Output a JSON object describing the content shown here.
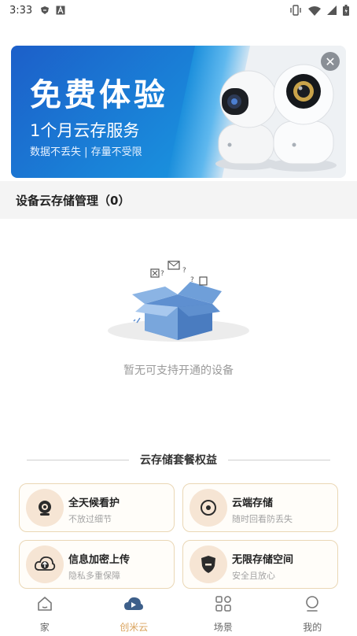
{
  "status_bar": {
    "time": "3:33",
    "left_icons": [
      "shield-icon",
      "a-badge-icon"
    ],
    "right_icons": [
      "vibrate-icon",
      "wifi-icon",
      "signal-icon",
      "battery-icon"
    ]
  },
  "banner": {
    "title": "免费体验",
    "subtitle": "1个月云存服务",
    "note": "数据不丢失 | 存量不受限",
    "close_symbol": "✕",
    "accent_color": "#1a78d6"
  },
  "devices": {
    "header": "设备云存储管理（0）",
    "empty_text": "暂无可支持开通的设备"
  },
  "benefits": {
    "title": "云存储套餐权益",
    "items": [
      {
        "title": "全天候看护",
        "desc": "不放过细节",
        "icon": "camera-icon"
      },
      {
        "title": "云端存储",
        "desc": "随时回看防丢失",
        "icon": "cloud-storage-icon"
      },
      {
        "title": "信息加密上传",
        "desc": "隐私多重保障",
        "icon": "upload-icon"
      },
      {
        "title": "无限存储空间",
        "desc": "安全且放心",
        "icon": "shield-icon"
      }
    ]
  },
  "tabbar": {
    "active_color": "#d9a25b",
    "tabs": [
      {
        "label": "家",
        "icon": "home-icon"
      },
      {
        "label": "创米云",
        "icon": "cloud-icon"
      },
      {
        "label": "场景",
        "icon": "scene-grid-icon"
      },
      {
        "label": "我的",
        "icon": "profile-icon"
      }
    ]
  }
}
